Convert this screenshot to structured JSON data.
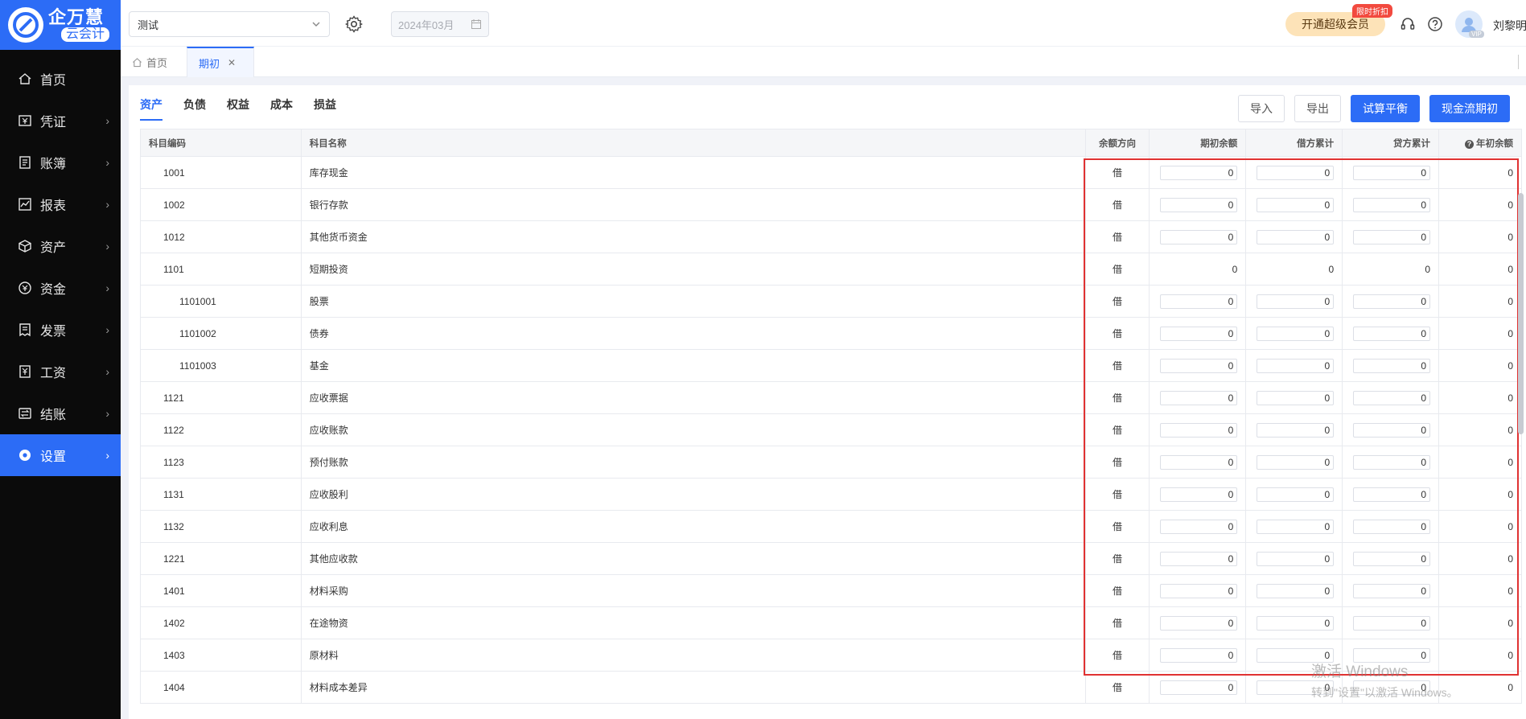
{
  "sidebar": {
    "logo_title": "企万慧",
    "logo_sub": "云会计",
    "items": [
      {
        "label": "首页",
        "icon": "home-icon",
        "arrow": false
      },
      {
        "label": "凭证",
        "icon": "voucher-icon",
        "arrow": true
      },
      {
        "label": "账簿",
        "icon": "ledger-icon",
        "arrow": true
      },
      {
        "label": "报表",
        "icon": "report-icon",
        "arrow": true
      },
      {
        "label": "资产",
        "icon": "asset-icon",
        "arrow": true
      },
      {
        "label": "资金",
        "icon": "fund-icon",
        "arrow": true
      },
      {
        "label": "发票",
        "icon": "invoice-icon",
        "arrow": true
      },
      {
        "label": "工资",
        "icon": "salary-icon",
        "arrow": true
      },
      {
        "label": "结账",
        "icon": "closing-icon",
        "arrow": true
      },
      {
        "label": "设置",
        "icon": "settings-icon",
        "arrow": true
      }
    ],
    "active_index": 9
  },
  "topbar": {
    "account_select": "测试",
    "period": "2024年03月",
    "vip_button": "开通超级会员",
    "vip_tag": "限时折扣",
    "avatar_badge": "VIP",
    "username": "刘黎明"
  },
  "tabs": {
    "home": "首页",
    "active": "期初"
  },
  "subtabs": [
    "资产",
    "负债",
    "权益",
    "成本",
    "损益"
  ],
  "actions": {
    "import": "导入",
    "export": "导出",
    "trial_balance": "试算平衡",
    "cash_flow_opening": "现金流期初"
  },
  "table": {
    "headers": {
      "code": "科目编码",
      "name": "科目名称",
      "direction": "余额方向",
      "opening": "期初余额",
      "debit": "借方累计",
      "credit": "贷方累计",
      "year_opening": "年初余额"
    },
    "rows": [
      {
        "code": "1001",
        "name": "库存现金",
        "dir": "借",
        "opening": "0",
        "debit": "0",
        "credit": "0",
        "year": "0",
        "level": 1,
        "editable": true
      },
      {
        "code": "1002",
        "name": "银行存款",
        "dir": "借",
        "opening": "0",
        "debit": "0",
        "credit": "0",
        "year": "0",
        "level": 1,
        "editable": true
      },
      {
        "code": "1012",
        "name": "其他货币资金",
        "dir": "借",
        "opening": "0",
        "debit": "0",
        "credit": "0",
        "year": "0",
        "level": 1,
        "editable": true
      },
      {
        "code": "1101",
        "name": "短期投资",
        "dir": "借",
        "opening": "0",
        "debit": "0",
        "credit": "0",
        "year": "0",
        "level": 1,
        "editable": false
      },
      {
        "code": "1101001",
        "name": "股票",
        "dir": "借",
        "opening": "0",
        "debit": "0",
        "credit": "0",
        "year": "0",
        "level": 2,
        "editable": true
      },
      {
        "code": "1101002",
        "name": "债券",
        "dir": "借",
        "opening": "0",
        "debit": "0",
        "credit": "0",
        "year": "0",
        "level": 2,
        "editable": true
      },
      {
        "code": "1101003",
        "name": "基金",
        "dir": "借",
        "opening": "0",
        "debit": "0",
        "credit": "0",
        "year": "0",
        "level": 2,
        "editable": true
      },
      {
        "code": "1121",
        "name": "应收票据",
        "dir": "借",
        "opening": "0",
        "debit": "0",
        "credit": "0",
        "year": "0",
        "level": 1,
        "editable": true
      },
      {
        "code": "1122",
        "name": "应收账款",
        "dir": "借",
        "opening": "0",
        "debit": "0",
        "credit": "0",
        "year": "0",
        "level": 1,
        "editable": true
      },
      {
        "code": "1123",
        "name": "预付账款",
        "dir": "借",
        "opening": "0",
        "debit": "0",
        "credit": "0",
        "year": "0",
        "level": 1,
        "editable": true
      },
      {
        "code": "1131",
        "name": "应收股利",
        "dir": "借",
        "opening": "0",
        "debit": "0",
        "credit": "0",
        "year": "0",
        "level": 1,
        "editable": true
      },
      {
        "code": "1132",
        "name": "应收利息",
        "dir": "借",
        "opening": "0",
        "debit": "0",
        "credit": "0",
        "year": "0",
        "level": 1,
        "editable": true
      },
      {
        "code": "1221",
        "name": "其他应收款",
        "dir": "借",
        "opening": "0",
        "debit": "0",
        "credit": "0",
        "year": "0",
        "level": 1,
        "editable": true
      },
      {
        "code": "1401",
        "name": "材料采购",
        "dir": "借",
        "opening": "0",
        "debit": "0",
        "credit": "0",
        "year": "0",
        "level": 1,
        "editable": true
      },
      {
        "code": "1402",
        "name": "在途物资",
        "dir": "借",
        "opening": "0",
        "debit": "0",
        "credit": "0",
        "year": "0",
        "level": 1,
        "editable": true
      },
      {
        "code": "1403",
        "name": "原材料",
        "dir": "借",
        "opening": "0",
        "debit": "0",
        "credit": "0",
        "year": "0",
        "level": 1,
        "editable": true
      },
      {
        "code": "1404",
        "name": "材料成本差异",
        "dir": "借",
        "opening": "0",
        "debit": "0",
        "credit": "0",
        "year": "0",
        "level": 1,
        "editable": true
      }
    ]
  },
  "watermark": {
    "line1": "激活 Windows",
    "line2": "转到\"设置\"以激活 Windows。"
  },
  "colors": {
    "primary": "#2c6cf6",
    "sidebar_bg": "#0b0b0b",
    "highlight_border": "#e03232",
    "vip_bg": "#fde3b8"
  }
}
